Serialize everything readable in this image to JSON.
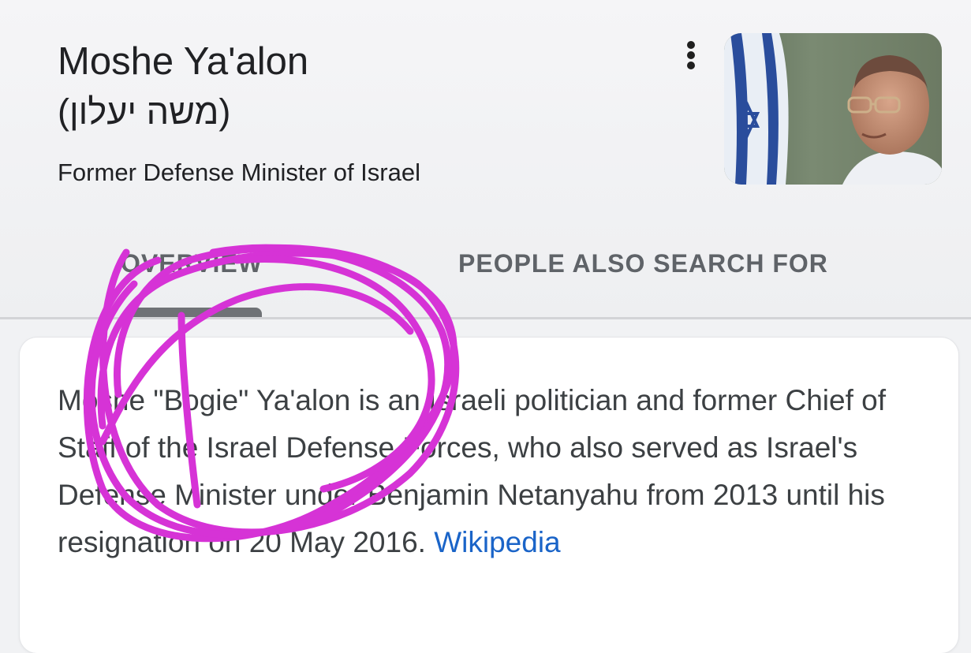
{
  "entity": {
    "name": "Moshe Ya'alon",
    "native_name": "(משה יעלון)",
    "description": "Former Defense Minister of Israel"
  },
  "menu": {
    "icon": "more-vert-icon"
  },
  "photo": {
    "subject": "portrait photo with Israeli flag"
  },
  "tabs": [
    {
      "label": "OVERVIEW",
      "selected": true
    },
    {
      "label": "PEOPLE ALSO SEARCH FOR",
      "selected": false
    }
  ],
  "overview": {
    "text": "Moshe \"Bogie\" Ya'alon is an Israeli politician and former Chief of Staff of the Israel Defense Forces, who also served as Israel's Defense Minister under Benjamin Netanyahu from 2013 until his resignation on 20 May 2016. ",
    "source_link": "Wikipedia"
  },
  "colors": {
    "scribble": "#d633d6",
    "link": "#1a64c8",
    "tab_text": "#5f6368",
    "tab_indicator": "#6f7276"
  }
}
